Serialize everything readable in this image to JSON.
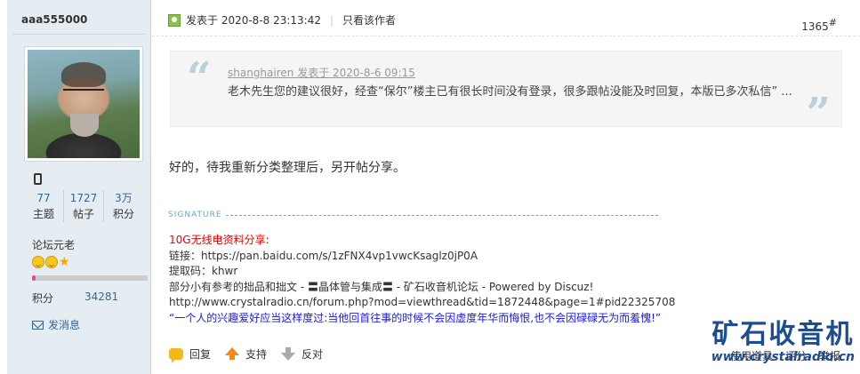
{
  "author": {
    "username": "aaa555000",
    "stats": [
      {
        "value": "77",
        "label": "主题"
      },
      {
        "value": "1727",
        "label": "帖子"
      },
      {
        "value": "3万",
        "label": "积分"
      }
    ],
    "group": "论坛元老",
    "level_progress_percent": 3,
    "points_label": "积分",
    "points_value": "34281",
    "message_label": "发消息"
  },
  "post": {
    "posted_at": "发表于 2020-8-8 23:13:42",
    "only_author": "只看该作者",
    "floor_number": "1365",
    "floor_symbol": "#",
    "quote": {
      "open_mark": "“",
      "close_mark": "”",
      "meta": "shanghairen 发表于 2020-8-6 09:15",
      "text": "老木先生您的建议很好，经查“保尔”楼主已有很长时间没有登录，很多跟帖没能及时回复，本版已多次私信” ..."
    },
    "body": "好的，待我重新分类整理后，另开帖分享。"
  },
  "signature": {
    "label": "SIGNATURE",
    "lines": {
      "title": "10G无线电资料分享:",
      "link": "链接：https://pan.baidu.com/s/1zFNX4vp1vwcKsaglz0jP0A",
      "code": "提取码：khwr",
      "ref": "部分小有参考的拙品和拙文 - 〓晶体管与集成〓 - 矿石收音机论坛 - Powered by Discuz!",
      "url": "http://www.crystalradio.cn/forum.php?mod=viewthread&tid=1872448&page=1#pid22325708",
      "motto": "“一个人的兴趣爱好应当这样度过:当他回首往事的时候不会因虚度年华而悔恨,也不会因碌碌无为而羞愧!”"
    }
  },
  "actions": {
    "reply": "回复",
    "support": "支持",
    "oppose": "反对"
  },
  "tools": {
    "tools_label": "使用道具",
    "rate_label": "评分",
    "report_label": "举报"
  },
  "watermark": {
    "title": "矿石收音机",
    "url": "www.crystalradio.cn"
  },
  "colors": {
    "sidebar_bg": "#e5edf2",
    "link_blue": "#336699",
    "signature_red": "#e00000",
    "motto_blue": "#1a1ae6",
    "progress_fill": "#e44a9a"
  }
}
